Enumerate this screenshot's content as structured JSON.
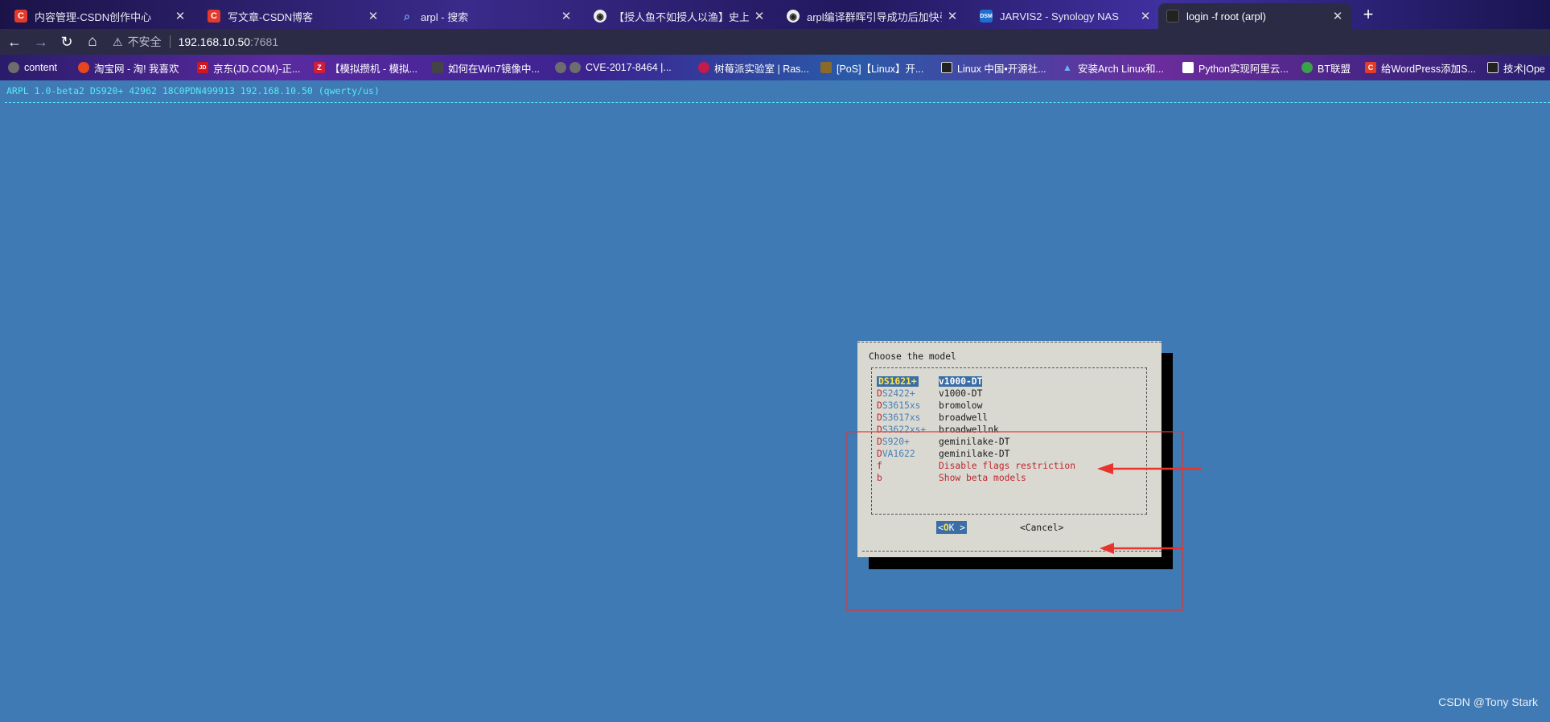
{
  "tabs": [
    {
      "title": "内容管理-CSDN创作中心",
      "favicon": "C"
    },
    {
      "title": "写文章-CSDN博客",
      "favicon": "C"
    },
    {
      "title": "arpl - 搜索",
      "favicon": "search"
    },
    {
      "title": "【授人鱼不如授人以渔】史上最",
      "favicon": "github"
    },
    {
      "title": "arpl编译群晖引导成功后加快引导",
      "favicon": "github"
    },
    {
      "title": "JARVIS2 - Synology NAS",
      "favicon": "DSM"
    },
    {
      "title": "login -f root (arpl)",
      "favicon": "terminal",
      "active": true
    }
  ],
  "address_bar": {
    "security_label": "不安全",
    "host": "192.168.10.50",
    "port": ":7681"
  },
  "bookmarks": [
    {
      "label": "content",
      "icon": "globe-icon",
      "color": "#6d6d6d"
    },
    {
      "label": "淘宝网 - 淘! 我喜欢",
      "icon": "taobao-icon",
      "color": "#e8461e"
    },
    {
      "label": "京东(JD.COM)-正...",
      "icon": "JD",
      "color": "#d0161e"
    },
    {
      "label": "【模拟攒机 - 模拟...",
      "icon": "Z",
      "color": "#cc1f3a"
    },
    {
      "label": "如何在Win7镜像中...",
      "icon": "msdn-icon",
      "color": "#444"
    },
    {
      "label": "CVE-2017-8464 |...",
      "icon": "globe-icon",
      "color": "#6d6d6d"
    },
    {
      "label": "树莓派实验室 | Ras...",
      "icon": "raspberry-icon",
      "color": "#c51a4a"
    },
    {
      "label": "[PoS]【Linux】开...",
      "icon": "box-icon",
      "color": "#8a6a2a"
    },
    {
      "label": "Linux 中国•开源社...",
      "icon": "linux-icon",
      "color": "#222"
    },
    {
      "label": "安装Arch Linux和...",
      "icon": "arch-icon",
      "color": "#1793d1"
    },
    {
      "label": "Python实现阿里云...",
      "icon": "doc-icon",
      "color": "#ffffff"
    },
    {
      "label": "BT联盟",
      "icon": "bt-icon",
      "color": "#3aa24a"
    },
    {
      "label": "给WordPress添加S...",
      "icon": "C",
      "color": "#e43c2a"
    },
    {
      "label": "技术|Ope",
      "icon": "linux-icon",
      "color": "#222"
    }
  ],
  "terminal": {
    "backtitle": "ARPL 1.0-beta2 DS920+ 42962 18C0PDN499913 192.168.10.50 (qwerty/us)",
    "dialog": {
      "title": "Choose the model",
      "items": [
        {
          "tag": "DS1621+",
          "item": "v1000-DT",
          "selected": true
        },
        {
          "tag": "DS2422+",
          "item": "v1000-DT"
        },
        {
          "tag": "DS3615xs",
          "item": "bromolow"
        },
        {
          "tag": "DS3617xs",
          "item": "broadwell"
        },
        {
          "tag": "DS3622xs+",
          "item": "broadwellnk"
        },
        {
          "tag": "DS920+",
          "item": "geminilake-DT"
        },
        {
          "tag": "DVA1622",
          "item": "geminilake-DT"
        },
        {
          "tag": "f",
          "item": "Disable flags restriction",
          "red": true
        },
        {
          "tag": "b",
          "item": "Show beta models",
          "red": true
        }
      ],
      "ok_button": "< OK >",
      "cancel_button": "<Cancel>"
    }
  },
  "watermark": "CSDN @Tony Stark",
  "colors": {
    "terminal_bg": "#3f7ab5",
    "dialog_bg": "#d9d9d2",
    "highlight": "#3a6ea5",
    "hotkey_red": "#c0262c",
    "annotation_red": "#e8352c",
    "backtitle_cyan": "#59e8f2"
  }
}
